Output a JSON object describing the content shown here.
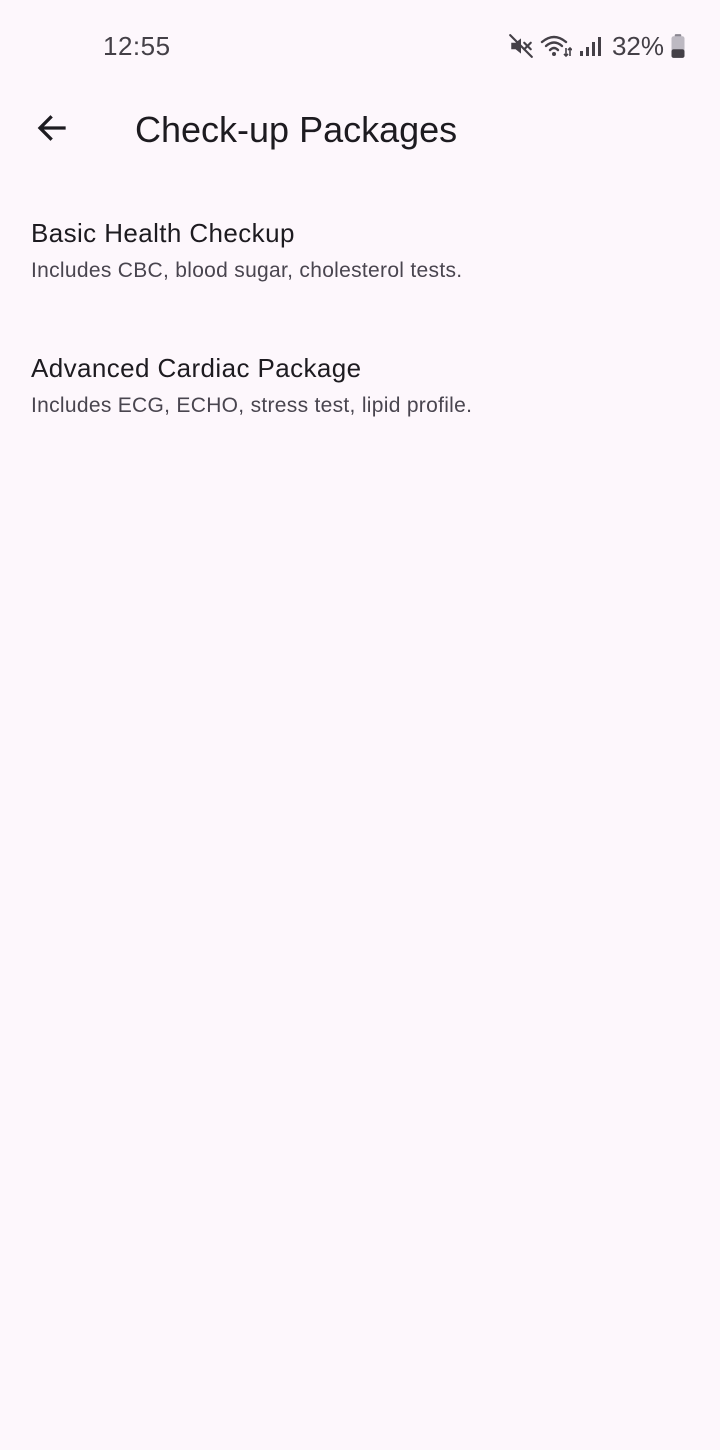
{
  "status_bar": {
    "time": "12:55",
    "battery_percent": "32%",
    "icons": [
      "mute-icon",
      "wifi-icon",
      "signal-icon",
      "battery-icon"
    ]
  },
  "app_bar": {
    "back_icon": "arrow-back-icon",
    "title": "Check-up Packages"
  },
  "packages": [
    {
      "title": "Basic Health Checkup",
      "description": "Includes CBC, blood sugar, cholesterol tests."
    },
    {
      "title": "Advanced Cardiac Package",
      "description": "Includes ECG, ECHO, stress test, lipid profile."
    }
  ],
  "colors": {
    "background": "#fdf7fc",
    "text_primary": "#1d1b20",
    "text_secondary": "#49454f",
    "status_text": "#444047"
  }
}
